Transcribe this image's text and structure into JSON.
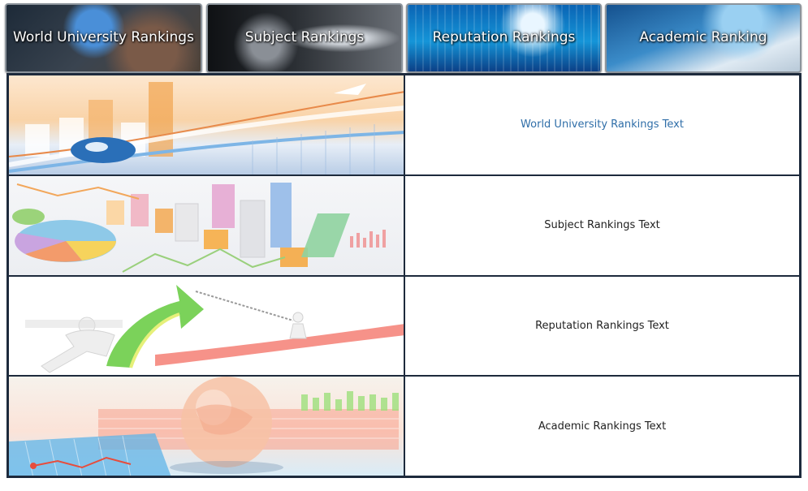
{
  "tabs": [
    {
      "label": "World University Rankings"
    },
    {
      "label": "Subject Rankings"
    },
    {
      "label": "Reputation Rankings"
    },
    {
      "label": "Academic Ranking"
    }
  ],
  "rows": [
    {
      "text": "World University Rankings Text"
    },
    {
      "text": "Subject Rankings Text"
    },
    {
      "text": "Reputation Rankings Text"
    },
    {
      "text": "Academic Rankings Text"
    }
  ],
  "colors": {
    "link_text": "#2f6ea8",
    "body_text": "#222222",
    "grid_border": "#1d2a3c"
  }
}
